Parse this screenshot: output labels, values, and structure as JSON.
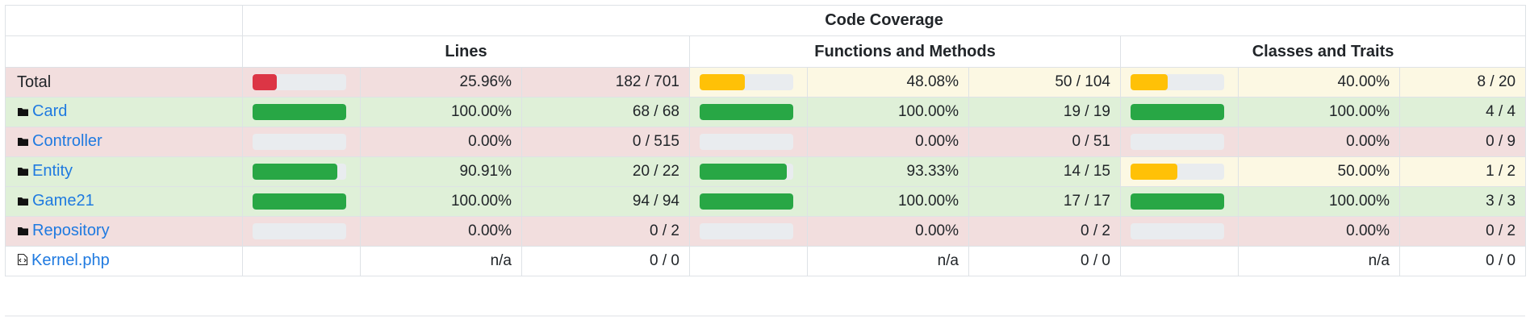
{
  "header": {
    "title": "Code Coverage",
    "columns": [
      "Lines",
      "Functions and Methods",
      "Classes and Traits"
    ]
  },
  "rows": [
    {
      "name": "Total",
      "kind": "total",
      "lines": {
        "level": "danger",
        "bar": 0.2596,
        "pct": "25.96%",
        "count": "182 / 701"
      },
      "functions": {
        "level": "warning",
        "bar": 0.4808,
        "pct": "48.08%",
        "count": "50 / 104"
      },
      "classes": {
        "level": "warning",
        "bar": 0.4,
        "pct": "40.00%",
        "count": "8 / 20"
      }
    },
    {
      "name": "Card",
      "kind": "directory",
      "lines": {
        "level": "success",
        "bar": 1.0,
        "pct": "100.00%",
        "count": "68 / 68"
      },
      "functions": {
        "level": "success",
        "bar": 1.0,
        "pct": "100.00%",
        "count": "19 / 19"
      },
      "classes": {
        "level": "success",
        "bar": 1.0,
        "pct": "100.00%",
        "count": "4 / 4"
      }
    },
    {
      "name": "Controller",
      "kind": "directory",
      "lines": {
        "level": "danger",
        "bar": 0.0,
        "pct": "0.00%",
        "count": "0 / 515"
      },
      "functions": {
        "level": "danger",
        "bar": 0.0,
        "pct": "0.00%",
        "count": "0 / 51"
      },
      "classes": {
        "level": "danger",
        "bar": 0.0,
        "pct": "0.00%",
        "count": "0 / 9"
      }
    },
    {
      "name": "Entity",
      "kind": "directory",
      "lines": {
        "level": "success",
        "bar": 0.9091,
        "pct": "90.91%",
        "count": "20 / 22"
      },
      "functions": {
        "level": "success",
        "bar": 0.9333,
        "pct": "93.33%",
        "count": "14 / 15"
      },
      "classes": {
        "level": "warning",
        "bar": 0.5,
        "pct": "50.00%",
        "count": "1 / 2"
      }
    },
    {
      "name": "Game21",
      "kind": "directory",
      "lines": {
        "level": "success",
        "bar": 1.0,
        "pct": "100.00%",
        "count": "94 / 94"
      },
      "functions": {
        "level": "success",
        "bar": 1.0,
        "pct": "100.00%",
        "count": "17 / 17"
      },
      "classes": {
        "level": "success",
        "bar": 1.0,
        "pct": "100.00%",
        "count": "3 / 3"
      }
    },
    {
      "name": "Repository",
      "kind": "directory",
      "lines": {
        "level": "danger",
        "bar": 0.0,
        "pct": "0.00%",
        "count": "0 / 2"
      },
      "functions": {
        "level": "danger",
        "bar": 0.0,
        "pct": "0.00%",
        "count": "0 / 2"
      },
      "classes": {
        "level": "danger",
        "bar": 0.0,
        "pct": "0.00%",
        "count": "0 / 2"
      }
    },
    {
      "name": "Kernel.php",
      "kind": "file",
      "lines": {
        "level": "none",
        "bar": null,
        "pct": "n/a",
        "count": "0 / 0"
      },
      "functions": {
        "level": "none",
        "bar": null,
        "pct": "n/a",
        "count": "0 / 0"
      },
      "classes": {
        "level": "none",
        "bar": null,
        "pct": "n/a",
        "count": "0 / 0"
      }
    }
  ],
  "icons": {
    "directory": "folder-icon",
    "file": "code-file-icon"
  },
  "colors": {
    "danger": "#dc3545",
    "warning": "#ffc107",
    "success": "#28a745",
    "row_danger": "#f2dede",
    "row_warning": "#fcf8e3",
    "row_success": "#dff0d8",
    "link": "#1f7ae0",
    "track": "#e9ecef"
  }
}
